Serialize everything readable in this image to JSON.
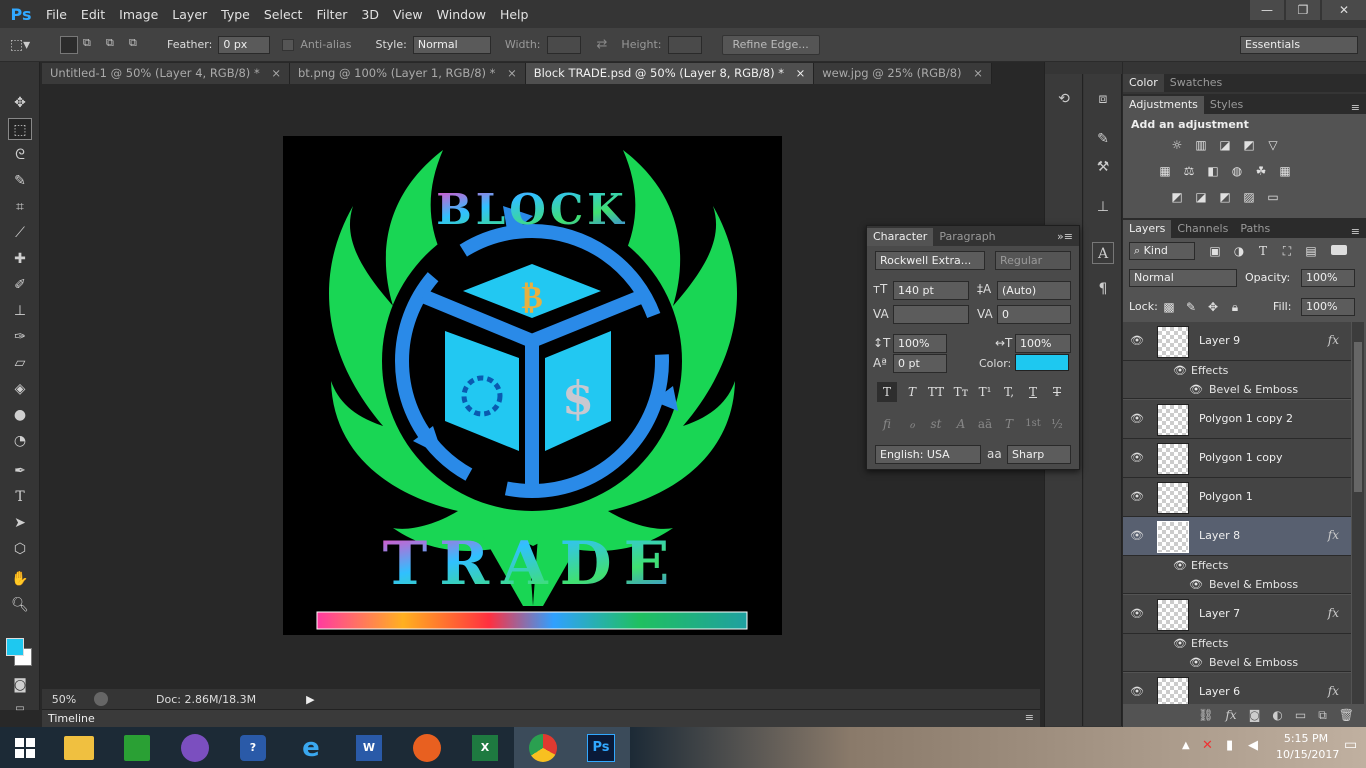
{
  "app": {
    "logo": "Ps"
  },
  "menu": [
    "File",
    "Edit",
    "Image",
    "Layer",
    "Type",
    "Select",
    "Filter",
    "3D",
    "View",
    "Window",
    "Help"
  ],
  "options": {
    "feather_label": "Feather:",
    "feather_value": "0 px",
    "antialias_label": "Anti-alias",
    "style_label": "Style:",
    "style_value": "Normal",
    "width_label": "Width:",
    "height_label": "Height:",
    "refine_edge": "Refine Edge...",
    "workspace": "Essentials"
  },
  "tabs": [
    "Untitled-1 @ 50% (Layer 4, RGB/8) *",
    "bt.png @ 100% (Layer 1, RGB/8) *",
    "Block TRADE.psd @ 50% (Layer 8, RGB/8) *",
    "wew.jpg @ 25% (RGB/8)"
  ],
  "artwork": {
    "top_text": "BLOCK",
    "bottom_text": "TRADE",
    "coin_top": "₿",
    "coin_right": "$"
  },
  "status": {
    "zoom": "50%",
    "doc": "Doc: 2.86M/18.3M"
  },
  "timeline": {
    "label": "Timeline"
  },
  "character": {
    "tabs": [
      "Character",
      "Paragraph"
    ],
    "font_family": "Rockwell Extra...",
    "font_style": "Regular",
    "size": "140 pt",
    "leading": "(Auto)",
    "kerning": "",
    "tracking": "0",
    "vscale": "100%",
    "hscale": "100%",
    "baseline": "0 pt",
    "color_label": "Color:",
    "color_value": "#1ec8f0",
    "language": "English: USA",
    "antialias_glyph": "aa",
    "antialias": "Sharp",
    "style_buttons": [
      "T",
      "T",
      "TT",
      "Tт",
      "T¹",
      "T,",
      "T",
      "T"
    ],
    "ot_buttons": [
      "fi",
      "ℴ",
      "st",
      "A",
      "aā",
      "T",
      "1st",
      "½"
    ]
  },
  "color_panel": {
    "tabs": [
      "Color",
      "Swatches"
    ]
  },
  "adjustments": {
    "tabs": [
      "Adjustments",
      "Styles"
    ],
    "title": "Add an adjustment"
  },
  "layers_panel": {
    "tabs": [
      "Layers",
      "Channels",
      "Paths"
    ],
    "filter_kind": "Kind",
    "blend": "Normal",
    "opacity_label": "Opacity:",
    "opacity": "100%",
    "lock_label": "Lock:",
    "fill_label": "Fill:",
    "fill": "100%",
    "layers": [
      {
        "name": "Layer 9",
        "fx": "fx"
      },
      {
        "name": "Polygon 1 copy 2"
      },
      {
        "name": "Polygon 1 copy"
      },
      {
        "name": "Polygon 1"
      },
      {
        "name": "Layer 8",
        "fx": "fx"
      },
      {
        "name": "Layer 7",
        "fx": "fx"
      },
      {
        "name": "Layer 6",
        "fx": "fx"
      }
    ],
    "effects_label": "Effects",
    "bevel_label": "Bevel & Emboss"
  },
  "taskbar": {
    "time": "5:15 PM",
    "date": "10/15/2017"
  },
  "colors": {
    "accent": "#31a8ff",
    "selected_layer": "#586070",
    "foreground": "#1ec8f0",
    "green": "#19d654",
    "blue": "#2a8ae8"
  }
}
